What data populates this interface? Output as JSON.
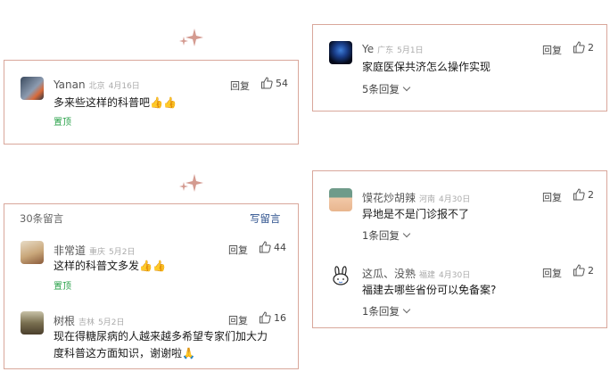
{
  "colors": {
    "panel_border": "#d9a79b",
    "sparkle": "#d49b90",
    "pin": "#2aa24a",
    "link": "#2b4f8c"
  },
  "icons": {
    "like": "thumbs-up-icon",
    "chevron": "chevron-down-icon",
    "sparkle": "sparkle-icon"
  },
  "panel_a": {
    "comment": {
      "name": "Yanan",
      "location": "北京",
      "date": "4月16日",
      "reply": "回复",
      "likes": "54",
      "text": "多来些这样的科普吧👍👍",
      "pinned": "置顶"
    }
  },
  "panel_b": {
    "comment": {
      "name": "Ye",
      "location": "广东",
      "date": "5月1日",
      "reply": "回复",
      "likes": "2",
      "text": "家庭医保共济怎么操作实现",
      "more": "5条回复"
    }
  },
  "panel_c": {
    "header": {
      "count": "30条留言",
      "write": "写留言"
    },
    "comments": [
      {
        "name": "非常道",
        "location": "重庆",
        "date": "5月2日",
        "reply": "回复",
        "likes": "44",
        "text": "这样的科普文多发👍👍",
        "pinned": "置顶"
      },
      {
        "name": "树根",
        "location": "吉林",
        "date": "5月2日",
        "reply": "回复",
        "likes": "16",
        "text_line1": "现在得糖尿病的人越来越多希望专家们加大力",
        "text_line2": "度科普这方面知识，谢谢啦🙏"
      }
    ]
  },
  "panel_d": {
    "comments": [
      {
        "name": "馍花炒胡辣",
        "location": "河南",
        "date": "4月30日",
        "reply": "回复",
        "likes": "2",
        "text": "异地是不是门诊报不了",
        "more": "1条回复"
      },
      {
        "name": "这瓜、没熟",
        "location": "福建",
        "date": "4月30日",
        "reply": "回复",
        "likes": "2",
        "text": "福建去哪些省份可以免备案?",
        "more": "1条回复"
      }
    ]
  }
}
